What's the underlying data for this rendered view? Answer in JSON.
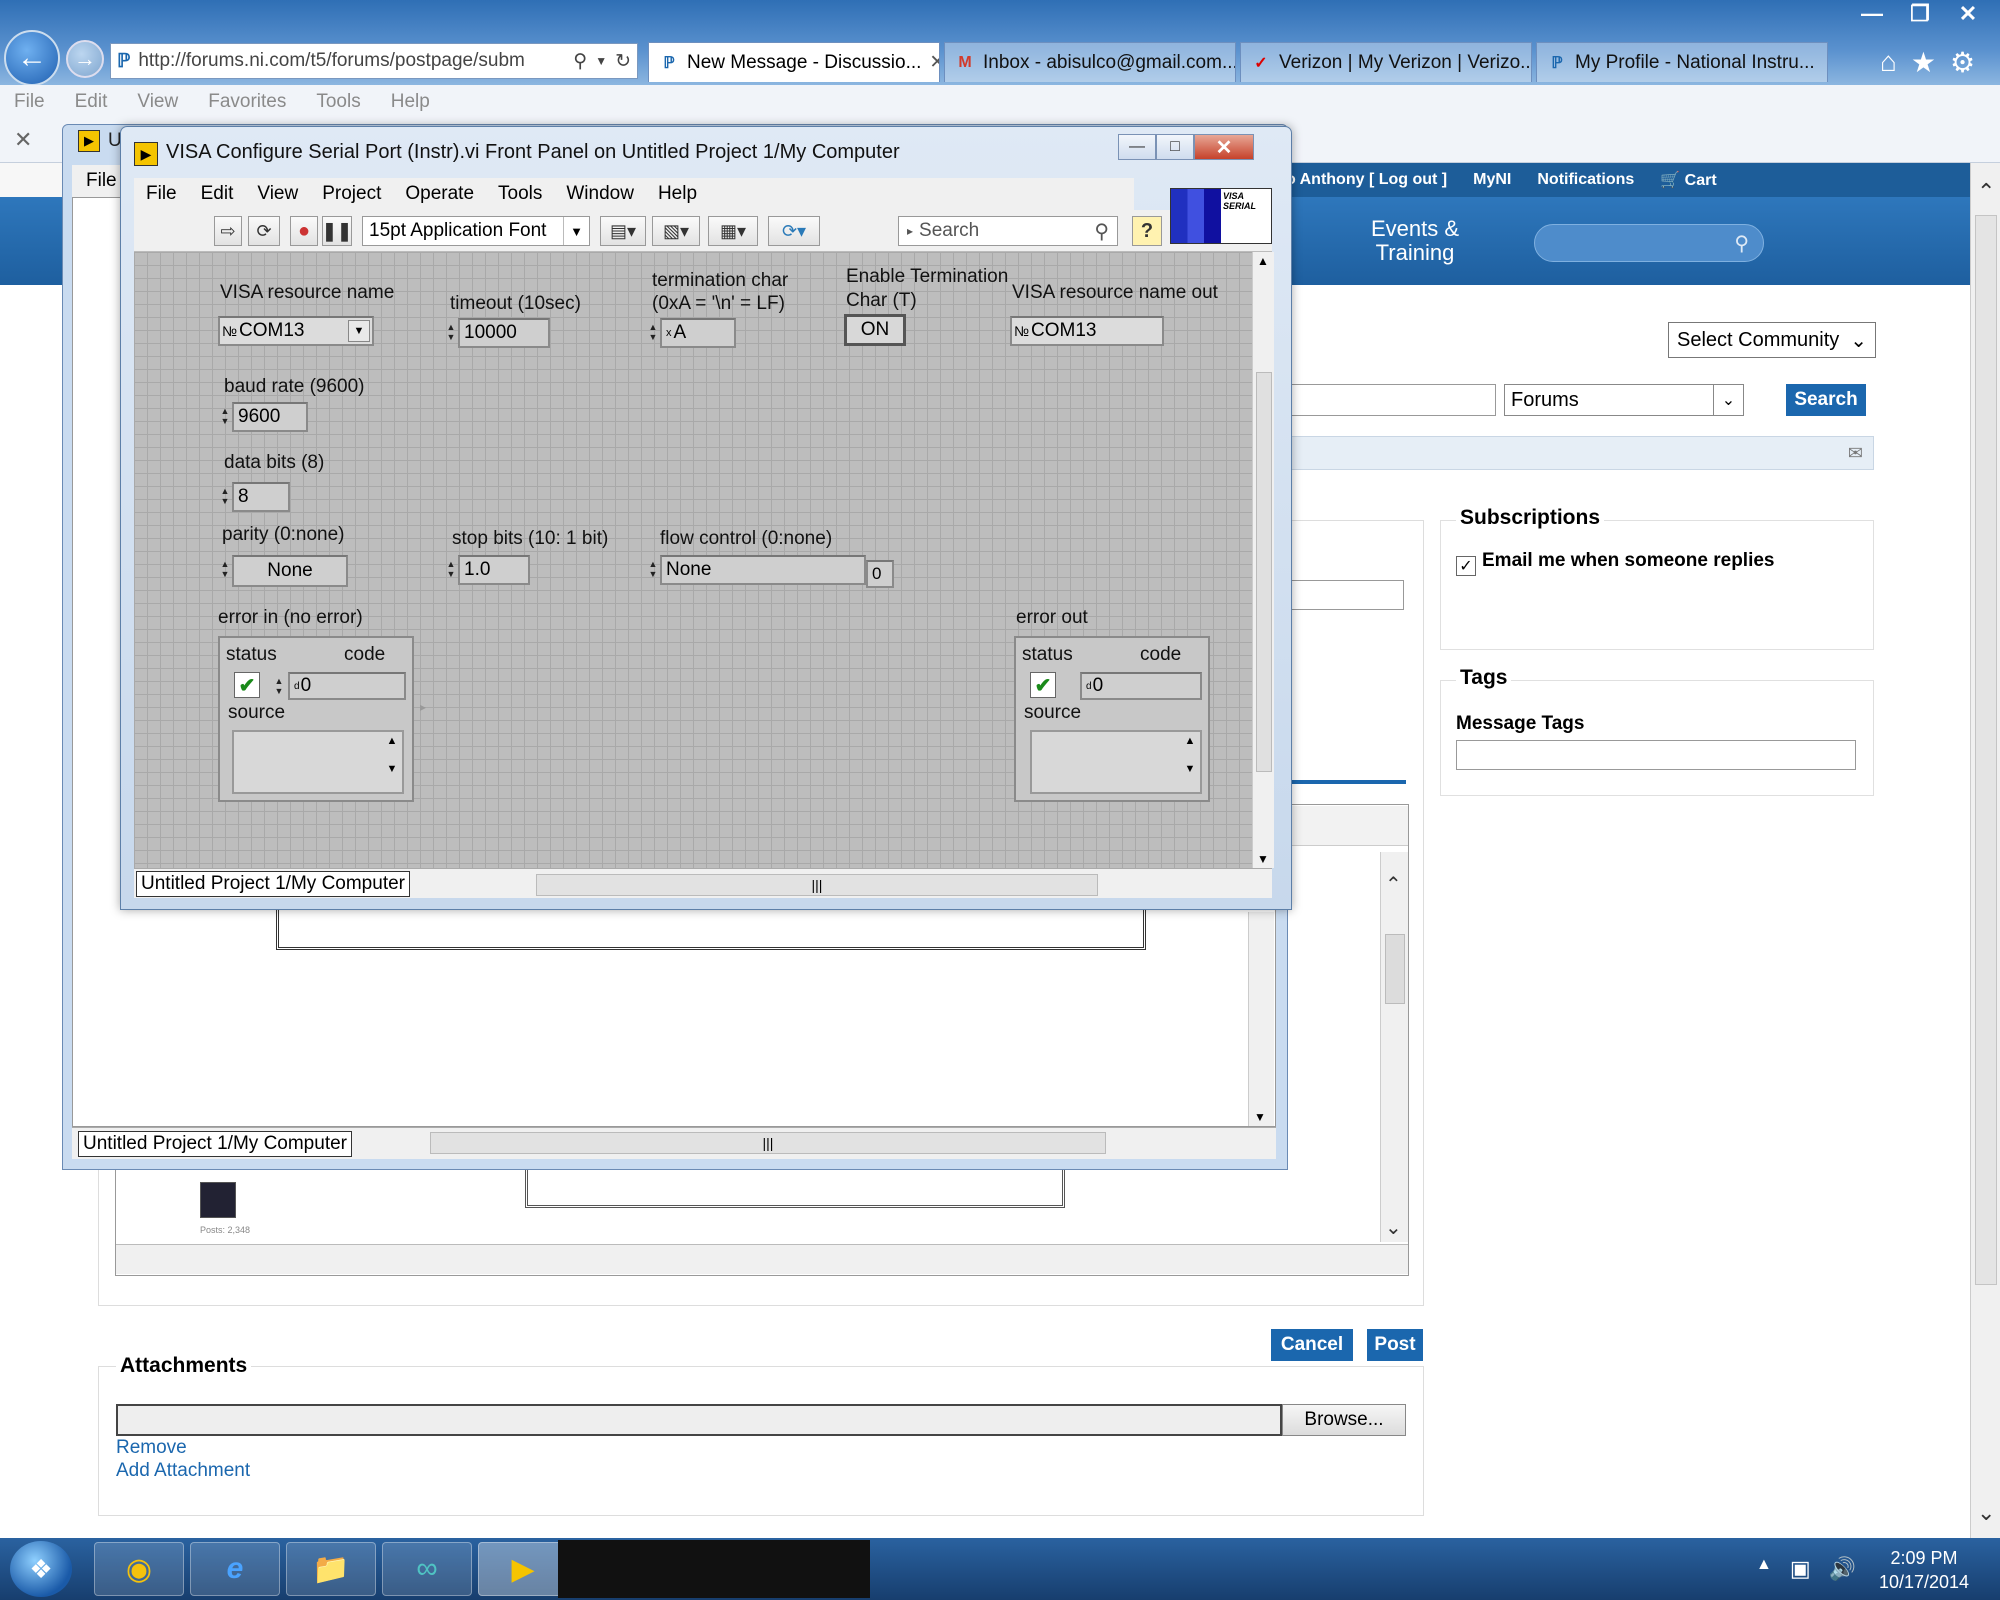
{
  "browser": {
    "url": "http://forums.ni.com/t5/forums/postpage/subm",
    "tabs": [
      {
        "label": "New Message - Discussio..."
      },
      {
        "label": "Inbox - abisulco@gmail.com..."
      },
      {
        "label": "Verizon | My Verizon | Verizo..."
      },
      {
        "label": "My Profile - National Instru..."
      }
    ],
    "menu": [
      "File",
      "Edit",
      "View",
      "Favorites",
      "Tools",
      "Help"
    ]
  },
  "site": {
    "top_strip": [
      "o Anthony [ Log out ]",
      "MyNI",
      "Notifications",
      "Cart"
    ],
    "nav_events": "Events & Training",
    "select_community": "Select Community",
    "forums_select": "Forums",
    "search_btn": "Search",
    "subscriptions_title": "Subscriptions",
    "email_replies": "Email me when someone replies",
    "tags_title": "Tags",
    "message_tags": "Message Tags",
    "cancel": "Cancel",
    "post": "Post",
    "attachments_title": "Attachments",
    "browse": "Browse...",
    "remove": "Remove",
    "add_attachment": "Add Attachment",
    "avatar_caption": "Posts: 2,348"
  },
  "back_window": {
    "title": "U",
    "menu_file": "File",
    "path": "Untitled Project 1/My Computer"
  },
  "lv": {
    "title": "VISA Configure Serial Port (Instr).vi Front Panel on Untitled Project 1/My Computer",
    "menu": [
      "File",
      "Edit",
      "View",
      "Project",
      "Operate",
      "Tools",
      "Window",
      "Help"
    ],
    "font": "15pt Application Font",
    "search_placeholder": "Search",
    "vi_icon_text": "VISA SERIAL",
    "path": "Untitled Project 1/My Computer",
    "controls": {
      "visa_resource_label": "VISA resource name",
      "visa_resource_value": "COM13",
      "timeout_label": "timeout (10sec)",
      "timeout_value": "10000",
      "termchar_label_1": "termination char",
      "termchar_label_2": "(0xA = '\\n' = LF)",
      "termchar_value": "A",
      "enable_term_label_1": "Enable Termination",
      "enable_term_label_2": "Char (T)",
      "enable_term_value": "ON",
      "visa_out_label": "VISA resource name out",
      "visa_out_value": "COM13",
      "baud_label": "baud rate (9600)",
      "baud_value": "9600",
      "databits_label": "data bits (8)",
      "databits_value": "8",
      "parity_label": "parity (0:none)",
      "parity_value": "None",
      "stopbits_label": "stop bits (10: 1 bit)",
      "stopbits_value": "1.0",
      "flow_label": "flow control (0:none)",
      "flow_value": "None",
      "flow_numeric": "0",
      "error_in_label": "error in (no error)",
      "error_out_label": "error out",
      "status_label": "status",
      "code_label": "code",
      "source_label": "source",
      "error_in_code": "0",
      "error_out_code": "0"
    }
  },
  "taskbar": {
    "time": "2:09 PM",
    "date": "10/17/2014"
  }
}
